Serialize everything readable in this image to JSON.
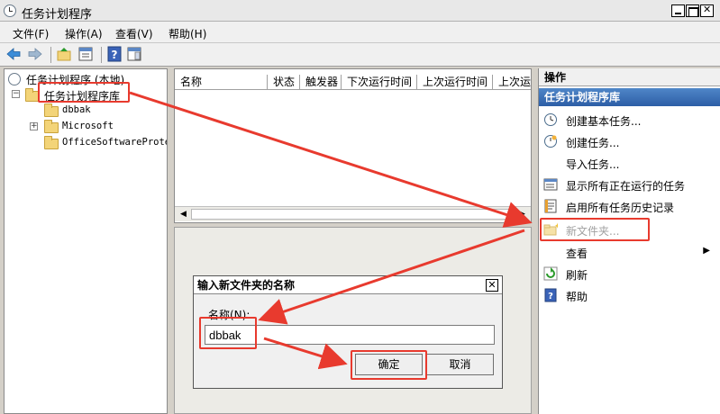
{
  "window": {
    "title": "任务计划程序"
  },
  "menu": {
    "items": [
      "文件(F)",
      "操作(A)",
      "查看(V)",
      "帮助(H)"
    ]
  },
  "toolbar": {
    "icons": [
      "back-arrow-icon",
      "forward-arrow-icon",
      "up-folder-icon",
      "view-icon",
      "help-icon",
      "panel-icon"
    ]
  },
  "tree": {
    "root": "任务计划程序 (本地)",
    "library": "任务计划程序库",
    "children": [
      "dbbak",
      "Microsoft",
      "OfficeSoftwareProte"
    ]
  },
  "list": {
    "columns": [
      "名称",
      "状态",
      "触发器",
      "下次运行时间",
      "上次运行时间",
      "上次运"
    ]
  },
  "dialog": {
    "title": "输入新文件夹的名称",
    "field_label": "名称(N):",
    "field_value": "dbbak",
    "ok_label": "确定",
    "cancel_label": "取消"
  },
  "actions": {
    "header": "操作",
    "section": "任务计划程序库",
    "items": [
      {
        "label": "创建基本任务...",
        "icon": "create-basic-task-icon"
      },
      {
        "label": "创建任务...",
        "icon": "create-task-icon"
      },
      {
        "label": "导入任务...",
        "icon": ""
      },
      {
        "label": "显示所有正在运行的任务",
        "icon": "running-tasks-icon"
      },
      {
        "label": "启用所有任务历史记录",
        "icon": "history-icon"
      },
      {
        "label": "新文件夹...",
        "icon": "new-folder-icon"
      },
      {
        "label": "查看",
        "icon": ""
      },
      {
        "label": "刷新",
        "icon": "refresh-icon"
      },
      {
        "label": "帮助",
        "icon": "help-icon"
      }
    ]
  },
  "colors": {
    "highlight": "#e83a2e",
    "section_blue": "#3a6db5"
  }
}
